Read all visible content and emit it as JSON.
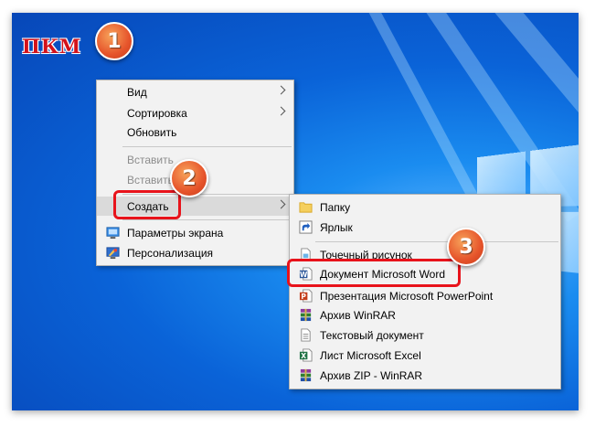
{
  "annotations": {
    "pkm_label": "ПКМ",
    "step1": "1",
    "step2": "2",
    "step3": "3"
  },
  "desktop_menu": {
    "items": [
      {
        "label": "Вид",
        "submenu": true
      },
      {
        "label": "Сортировка",
        "submenu": true
      },
      {
        "label": "Обновить"
      },
      {
        "label": "Вставить",
        "disabled": true
      },
      {
        "label": "Вставить ярлык",
        "disabled": true
      },
      {
        "label": "Создать",
        "submenu": true,
        "highlighted": true
      },
      {
        "label": "Параметры экрана",
        "icon": "display-settings-icon"
      },
      {
        "label": "Персонализация",
        "icon": "personalization-icon"
      }
    ]
  },
  "create_submenu": {
    "items": [
      {
        "label": "Папку",
        "icon": "folder-icon"
      },
      {
        "label": "Ярлык",
        "icon": "shortcut-icon"
      },
      {
        "label": "Точечный рисунок",
        "icon": "bitmap-icon"
      },
      {
        "label": "Документ Microsoft Word",
        "icon": "word-document-icon"
      },
      {
        "label": "Презентация Microsoft PowerPoint",
        "icon": "powerpoint-icon"
      },
      {
        "label": "Архив WinRAR",
        "icon": "winrar-archive-icon"
      },
      {
        "label": "Текстовый документ",
        "icon": "text-document-icon"
      },
      {
        "label": "Лист Microsoft Excel",
        "icon": "excel-icon"
      },
      {
        "label": "Архив ZIP - WinRAR",
        "icon": "winrar-zip-icon"
      }
    ]
  },
  "colors": {
    "highlight_box": "#e8131b",
    "badge": "#e6542b",
    "desktop": "#0a63d8"
  }
}
